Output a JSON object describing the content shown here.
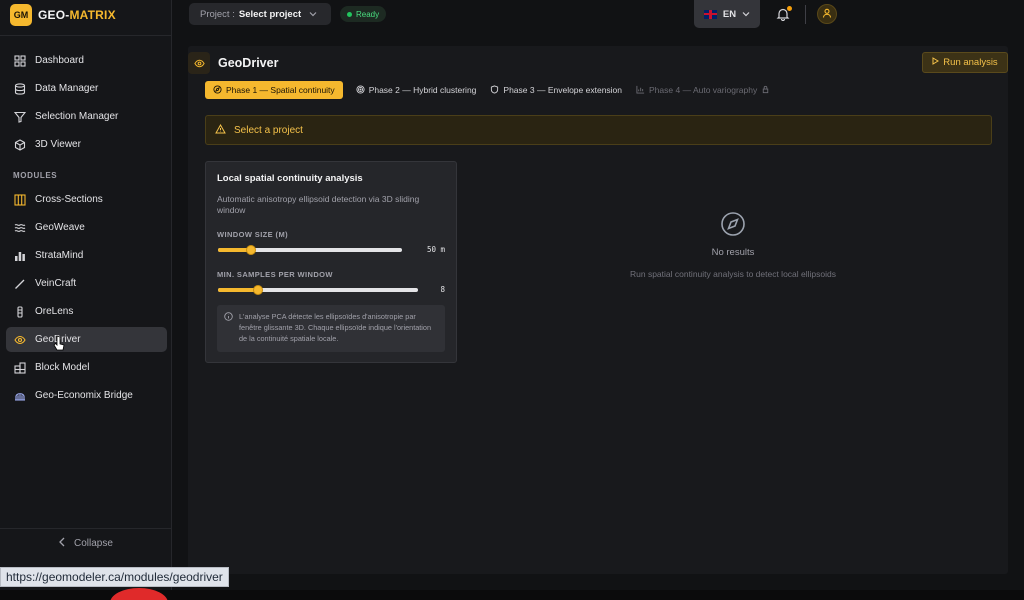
{
  "brand": {
    "logo": "GM",
    "name_main": "GEO-",
    "name_accent": "MATRIX"
  },
  "sidebar": {
    "main_items": [
      {
        "label": "Dashboard",
        "icon": "grid-icon"
      },
      {
        "label": "Data Manager",
        "icon": "database-icon"
      },
      {
        "label": "Selection Manager",
        "icon": "filter-icon"
      },
      {
        "label": "3D Viewer",
        "icon": "cube-icon"
      }
    ],
    "modules_label": "MODULES",
    "module_items": [
      {
        "label": "Cross-Sections",
        "icon": "columns-icon"
      },
      {
        "label": "GeoWeave",
        "icon": "waves-icon"
      },
      {
        "label": "StrataMind",
        "icon": "bars-icon"
      },
      {
        "label": "VeinCraft",
        "icon": "pen-icon"
      },
      {
        "label": "OreLens",
        "icon": "tube-icon"
      },
      {
        "label": "GeoDriver",
        "icon": "eye-icon",
        "active": true
      },
      {
        "label": "Block Model",
        "icon": "blocks-icon"
      },
      {
        "label": "Geo-Economix Bridge",
        "icon": "bridge-icon"
      }
    ],
    "collapse_label": "Collapse"
  },
  "topbar": {
    "project_label": "Project :",
    "project_value": "Select project",
    "status": "Ready",
    "language": "EN"
  },
  "main": {
    "title": "GeoDriver",
    "run_label": "Run analysis",
    "tabs": [
      {
        "label": "Phase 1 — Spatial continuity",
        "state": "active"
      },
      {
        "label": "Phase 2 — Hybrid clustering",
        "state": "normal"
      },
      {
        "label": "Phase 3 — Envelope extension",
        "state": "normal"
      },
      {
        "label": "Phase 4 — Auto variography",
        "state": "disabled"
      }
    ],
    "alert": "Select a project",
    "card": {
      "title": "Local spatial continuity analysis",
      "description": "Automatic anisotropy ellipsoid detection via 3D sliding window",
      "window_label": "WINDOW SIZE (M)",
      "window_value": "50 m",
      "window_fraction": 0.18,
      "samples_label": "MIN. SAMPLES PER WINDOW",
      "samples_value": "8",
      "samples_fraction": 0.2,
      "info": "L'analyse PCA détecte les ellipsoïdes d'anisotropie par fenêtre glissante 3D. Chaque ellipsoïde indique l'orientation de la continuité spatiale locale."
    },
    "empty": {
      "title": "No results",
      "subtitle": "Run spatial continuity analysis to detect local ellipsoids"
    }
  },
  "status_url": "https://geomodeler.ca/modules/geodriver",
  "colors": {
    "accent": "#f5b82e",
    "success": "#22c55e"
  }
}
